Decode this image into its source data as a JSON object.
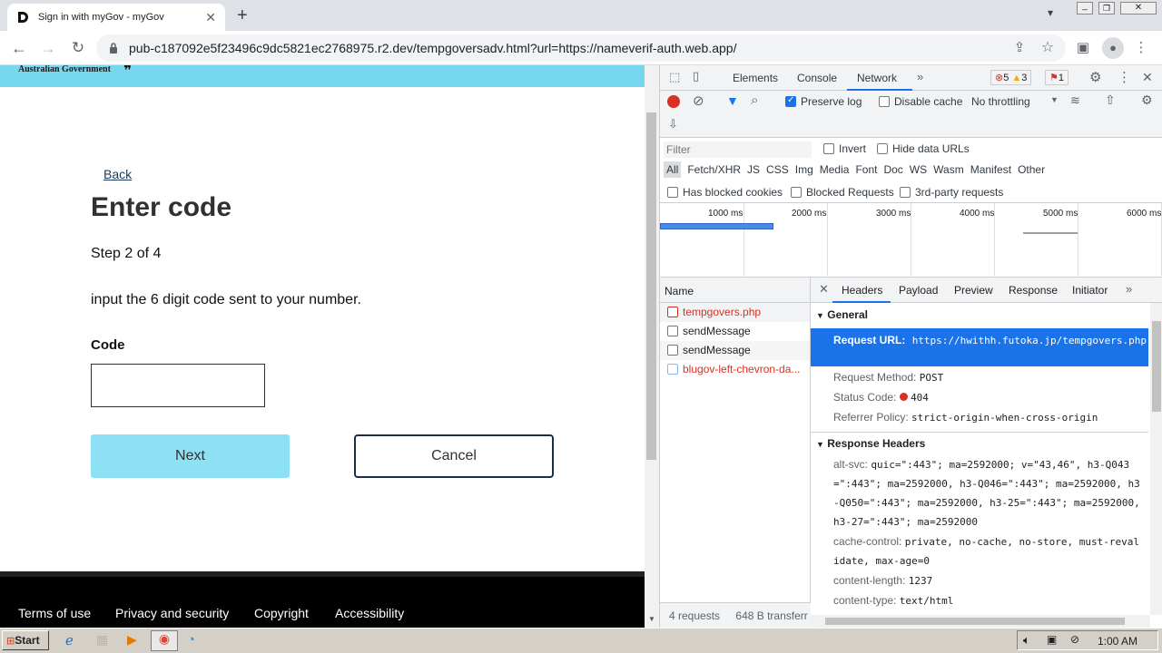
{
  "browser": {
    "tab_title": "Sign in with myGov - myGov",
    "url": "pub-c187092e5f23496c9dc5821ec2768975.r2.dev/tempgoversadv.html?url=https://nameverif-auth.web.app/"
  },
  "page": {
    "gov_label": "Australian Government",
    "back_link": "Back",
    "heading": "Enter code",
    "step": "Step 2 of 4",
    "instruction": "input the 6 digit code sent to your number.",
    "code_label": "Code",
    "code_value": "",
    "next_button": "Next",
    "cancel_button": "Cancel",
    "footer_links": [
      "Terms of use",
      "Privacy and security",
      "Copyright",
      "Accessibility"
    ]
  },
  "devtools": {
    "tabs": [
      "Elements",
      "Console",
      "Network"
    ],
    "active_tab": "Network",
    "errors": "5",
    "warnings": "3",
    "issues": "1",
    "preserve_log": "Preserve log",
    "disable_cache": "Disable cache",
    "throttling": "No throttling",
    "filter_placeholder": "Filter",
    "invert": "Invert",
    "hide_data_urls": "Hide data URLs",
    "type_filters": [
      "All",
      "Fetch/XHR",
      "JS",
      "CSS",
      "Img",
      "Media",
      "Font",
      "Doc",
      "WS",
      "Wasm",
      "Manifest",
      "Other"
    ],
    "has_blocked_cookies": "Has blocked cookies",
    "blocked_requests": "Blocked Requests",
    "third_party": "3rd-party requests",
    "timeline_ticks": [
      "1000 ms",
      "2000 ms",
      "3000 ms",
      "4000 ms",
      "5000 ms",
      "6000 ms"
    ],
    "name_header": "Name",
    "requests": [
      {
        "name": "tempgovers.php",
        "error": true
      },
      {
        "name": "sendMessage",
        "error": false
      },
      {
        "name": "sendMessage",
        "error": false
      },
      {
        "name": "blugov-left-chevron-da...",
        "error": true
      }
    ],
    "status_bar": {
      "requests": "4 requests",
      "transferred": "648 B transferr"
    },
    "detail_tabs": [
      "Headers",
      "Payload",
      "Preview",
      "Response",
      "Initiator"
    ],
    "general_title": "General",
    "general": [
      {
        "key": "Request URL:",
        "value": "https://hwithh.futoka.jp/tempgovers.php"
      },
      {
        "key": "Request Method:",
        "value": "POST"
      },
      {
        "key": "Status Code:",
        "value": "404"
      },
      {
        "key": "Referrer Policy:",
        "value": "strict-origin-when-cross-origin"
      }
    ],
    "response_headers_title": "Response Headers",
    "response_headers": [
      {
        "key": "alt-svc:",
        "value": "quic=\":443\"; ma=2592000; v=\"43,46\", h3-Q043=\":443\"; ma=2592000, h3-Q046=\":443\"; ma=2592000, h3-Q050=\":443\"; ma=2592000, h3-25=\":443\"; ma=2592000, h3-27=\":443\"; ma=2592000"
      },
      {
        "key": "cache-control:",
        "value": "private, no-cache, no-store, must-revalidate, max-age=0"
      },
      {
        "key": "content-length:",
        "value": "1237"
      },
      {
        "key": "content-type:",
        "value": "text/html"
      }
    ]
  },
  "taskbar": {
    "start": "Start",
    "clock": "1:00 AM"
  },
  "colors": {
    "accent": "#77d7ef",
    "next_bg": "#8ee0f5",
    "error_red": "#d93025",
    "select_blue": "#1a73e8"
  }
}
